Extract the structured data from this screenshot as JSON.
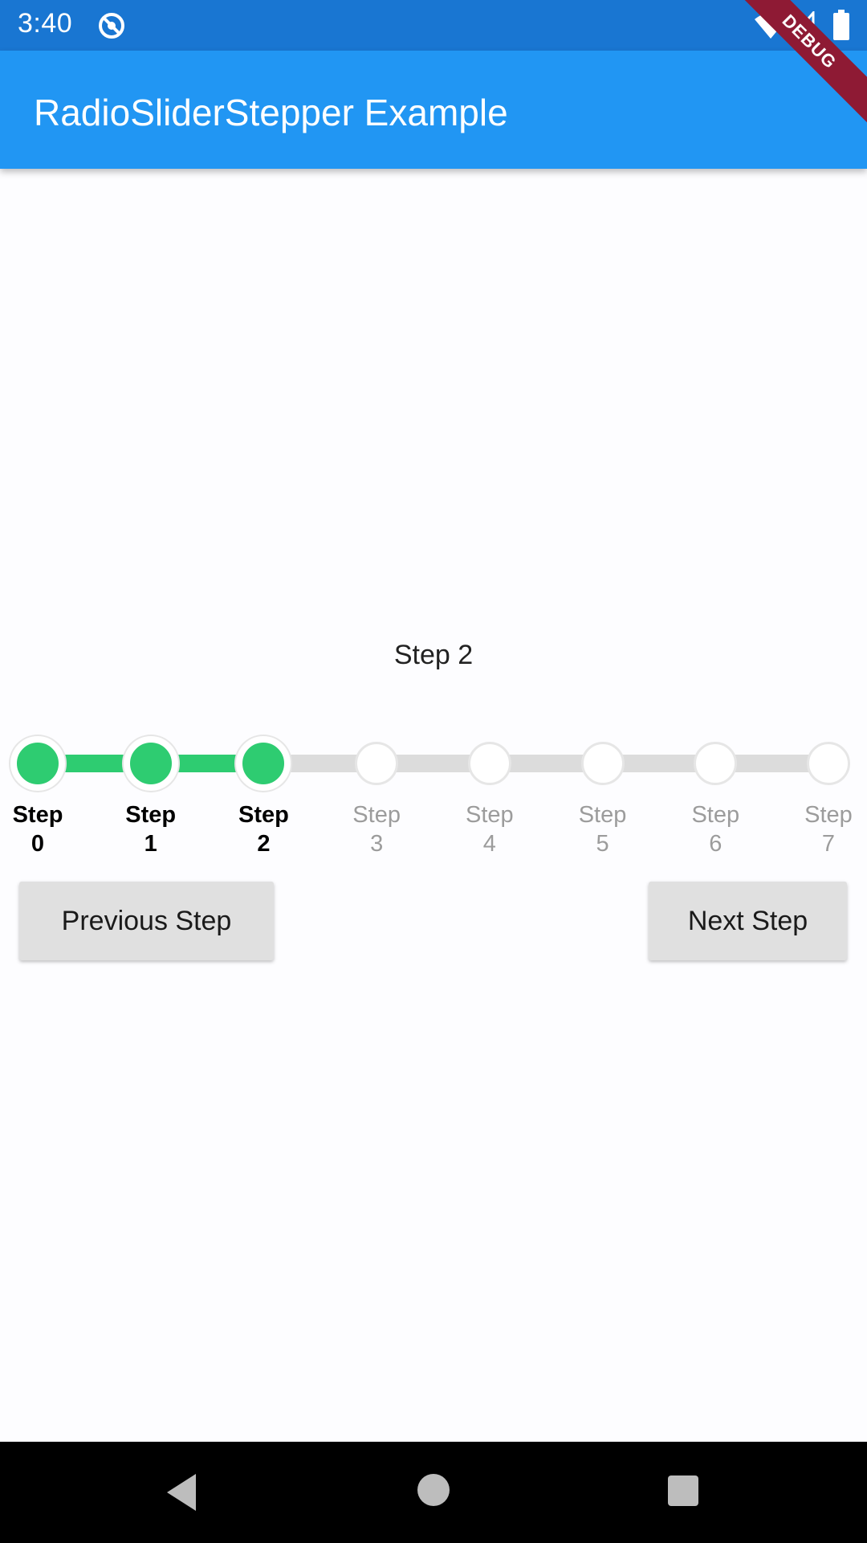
{
  "status_bar": {
    "time": "3:40",
    "icons": [
      "sync-off-icon",
      "wifi-icon",
      "signal-icon",
      "battery-icon"
    ]
  },
  "app_bar": {
    "title": "RadioSliderStepper Example",
    "debug_banner": "DEBUG"
  },
  "content": {
    "current_step_text": "Step 2",
    "current_step_index": 2,
    "steps": [
      {
        "word": "Step",
        "num": "0"
      },
      {
        "word": "Step",
        "num": "1"
      },
      {
        "word": "Step",
        "num": "2"
      },
      {
        "word": "Step",
        "num": "3"
      },
      {
        "word": "Step",
        "num": "4"
      },
      {
        "word": "Step",
        "num": "5"
      },
      {
        "word": "Step",
        "num": "6"
      },
      {
        "word": "Step",
        "num": "7"
      }
    ],
    "colors": {
      "done": "#2ecc71",
      "todo": "#dcdcdc"
    },
    "prev_button": "Previous Step",
    "next_button": "Next Step"
  },
  "nav_bar": {
    "icons": [
      "back-icon",
      "home-icon",
      "recent-apps-icon"
    ]
  }
}
